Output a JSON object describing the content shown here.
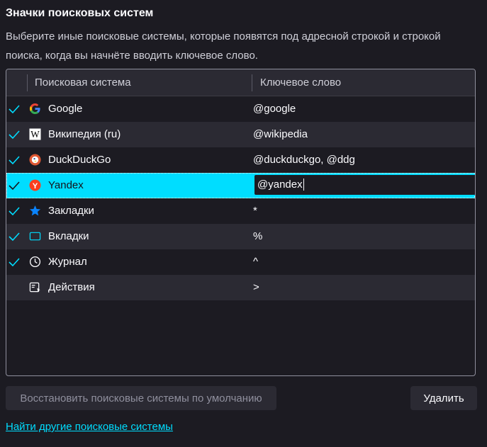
{
  "section": {
    "title": "Значки поисковых систем",
    "description": "Выберите иные поисковые системы, которые появятся под адресной строкой и строкой поиска, когда вы начнёте вводить ключевое слово."
  },
  "table": {
    "columns": [
      "Поисковая система",
      "Ключевое слово"
    ],
    "rows": [
      {
        "name": "Google",
        "keyword": "@google",
        "checked": true,
        "icon": "google-icon"
      },
      {
        "name": "Википедия (ru)",
        "keyword": "@wikipedia",
        "checked": true,
        "icon": "wikipedia-icon"
      },
      {
        "name": "DuckDuckGo",
        "keyword": "@duckduckgo, @ddg",
        "checked": true,
        "icon": "duckduckgo-icon"
      },
      {
        "name": "Yandex",
        "keyword": "@yandex",
        "checked": true,
        "icon": "yandex-icon",
        "selected": true
      },
      {
        "name": "Закладки",
        "keyword": "*",
        "checked": true,
        "icon": "bookmark-star-icon"
      },
      {
        "name": "Вкладки",
        "keyword": "%",
        "checked": true,
        "icon": "tabs-icon"
      },
      {
        "name": "Журнал",
        "keyword": "^",
        "checked": true,
        "icon": "history-clock-icon"
      },
      {
        "name": "Действия",
        "keyword": ">",
        "checked": false,
        "icon": "actions-icon"
      }
    ]
  },
  "buttons": {
    "restore": "Восстановить поисковые системы по умолчанию",
    "delete": "Удалить"
  },
  "link": "Найти другие поисковые системы",
  "colors": {
    "background": "#1c1b22",
    "accent": "#00ddff",
    "row_alt": "#2b2a33"
  }
}
